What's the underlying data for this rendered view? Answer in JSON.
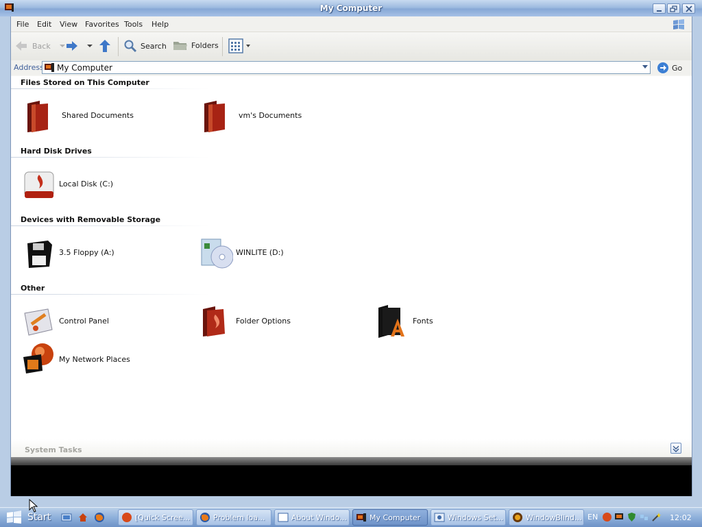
{
  "window": {
    "title": "My Computer"
  },
  "menu": {
    "items": [
      "File",
      "Edit",
      "View",
      "Favorites",
      "Tools",
      "Help"
    ]
  },
  "toolbar": {
    "back_label": "Back",
    "search_label": "Search",
    "folders_label": "Folders"
  },
  "address": {
    "label": "Address",
    "value": "My Computer",
    "go_label": "Go"
  },
  "groups": [
    {
      "header": "Files Stored on This Computer",
      "items": [
        "Shared Documents",
        "vm's Documents"
      ]
    },
    {
      "header": "Hard Disk Drives",
      "items": [
        "Local Disk (C:)"
      ]
    },
    {
      "header": "Devices with Removable Storage",
      "items": [
        "3.5 Floppy (A:)",
        "WINLITE (D:)"
      ]
    },
    {
      "header": "Other",
      "items": [
        "Control Panel",
        "Folder Options",
        "Fonts",
        "My Network Places"
      ]
    }
  ],
  "tasks": {
    "label": "System Tasks"
  },
  "taskbar": {
    "start_label": "Start",
    "tasks": [
      {
        "label": "[Quick Scree...",
        "active": false
      },
      {
        "label": "Problem loa...",
        "active": false
      },
      {
        "label": "About Windo...",
        "active": false
      },
      {
        "label": "My Computer",
        "active": true
      },
      {
        "label": "Windows Set...",
        "active": false
      },
      {
        "label": "WindowBlind...",
        "active": false
      }
    ],
    "language": "EN",
    "clock": "12:02"
  },
  "colors": {
    "folder_red": "#8b1a10",
    "title_blue": "#87a8d6",
    "address_label": "#3f5f9a"
  }
}
